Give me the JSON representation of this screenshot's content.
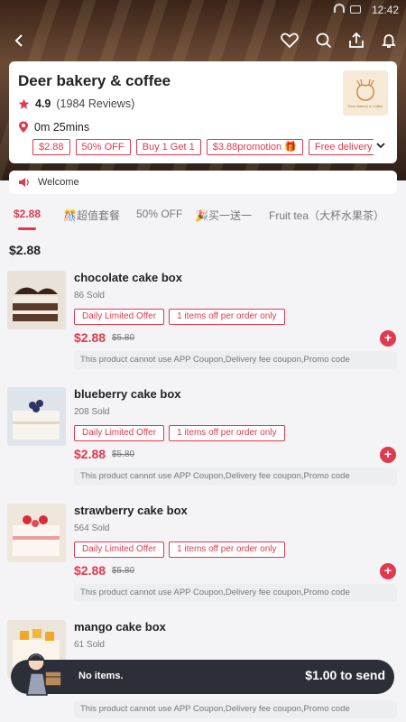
{
  "status_bar": {
    "time": "12:42"
  },
  "store": {
    "name": "Deer bakery & coffee",
    "rating": "4.9",
    "reviews": "(1984 Reviews)",
    "delivery_time": "0m 25mins",
    "logo_text": "Deer Bakery & Coffee",
    "tags": [
      "$2.88",
      "50% OFF",
      "Buy 1 Get 1",
      "$3.88promotion 🎁",
      "Free delivery"
    ]
  },
  "welcome": "Welcome",
  "categories": [
    "$2.88",
    "🎊超值套餐",
    "50% OFF",
    "🎉买一送一",
    "Fruit tea（大杯水果茶）"
  ],
  "section_title": "$2.88",
  "products": [
    {
      "name": "chocolate cake box",
      "sold": "86 Sold",
      "badge1": "Daily Limited Offer",
      "badge2": "1 items off per order only",
      "price": "$2.88",
      "old_price": "$5.80",
      "note": "This product cannot use APP Coupon,Delivery fee coupon,Promo code"
    },
    {
      "name": "blueberry cake box",
      "sold": "208 Sold",
      "badge1": "Daily Limited Offer",
      "badge2": "1 items off per order only",
      "price": "$2.88",
      "old_price": "$5.80",
      "note": "This product cannot use APP Coupon,Delivery fee coupon,Promo code"
    },
    {
      "name": "strawberry cake box",
      "sold": "564 Sold",
      "badge1": "Daily Limited Offer",
      "badge2": "1 items off per order only",
      "price": "$2.88",
      "old_price": "$5.80",
      "note": "This product cannot use APP Coupon,Delivery fee coupon,Promo code"
    },
    {
      "name": "mango cake box",
      "sold": "61 Sold",
      "badge1": "",
      "badge2": "",
      "price": "",
      "old_price": "",
      "note": "This product cannot use APP Coupon,Delivery fee coupon,Promo code"
    }
  ],
  "cart": {
    "status": "No items.",
    "min_send": "$1.00 to send"
  },
  "colors": {
    "accent": "#e03a4e",
    "cart_bg": "#2d2f38"
  }
}
